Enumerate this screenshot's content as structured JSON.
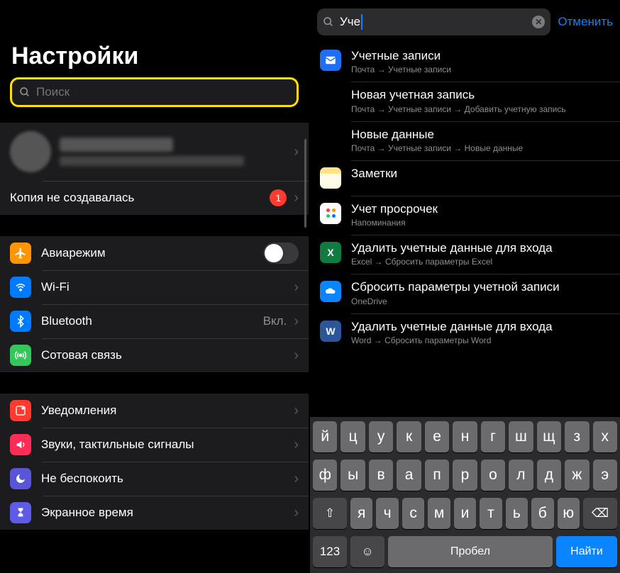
{
  "left": {
    "title": "Настройки",
    "search_placeholder": "Поиск",
    "backup_label": "Копия не создавалась",
    "backup_badge": "1",
    "rows1": [
      {
        "label": "Авиарежим"
      },
      {
        "label": "Wi-Fi"
      },
      {
        "label": "Bluetooth",
        "value": "Вкл."
      },
      {
        "label": "Сотовая связь"
      }
    ],
    "rows2": [
      {
        "label": "Уведомления"
      },
      {
        "label": "Звуки, тактильные сигналы"
      },
      {
        "label": "Не беспокоить"
      },
      {
        "label": "Экранное время"
      }
    ]
  },
  "right": {
    "query": "Уче",
    "cancel": "Отменить",
    "results": [
      {
        "icon": "mail",
        "title": "Учетные записи",
        "crumb": "Почта → Учетные записи"
      },
      {
        "icon": "none",
        "title": "Новая учетная запись",
        "crumb": "Почта → Учетные записи → Добавить учетную запись"
      },
      {
        "icon": "none",
        "title": "Новые данные",
        "crumb": "Почта → Учетные записи → Новые данные"
      },
      {
        "icon": "notes",
        "title": "Заметки",
        "crumb": ""
      },
      {
        "icon": "rem",
        "title": "Учет просрочек",
        "crumb": "Напоминания"
      },
      {
        "icon": "excel",
        "title": "Удалить учетные данные для входа",
        "crumb": "Excel → Сбросить параметры Excel"
      },
      {
        "icon": "od",
        "title": "Сбросить параметры учетной записи",
        "crumb": "OneDrive"
      },
      {
        "icon": "word",
        "title": "Удалить учетные данные для входа",
        "crumb": "Word → Сбросить параметры Word"
      }
    ],
    "keyboard": {
      "row1": [
        "й",
        "ц",
        "у",
        "к",
        "е",
        "н",
        "г",
        "ш",
        "щ",
        "з",
        "х"
      ],
      "row2": [
        "ф",
        "ы",
        "в",
        "а",
        "п",
        "р",
        "о",
        "л",
        "д",
        "ж",
        "э"
      ],
      "row3": [
        "я",
        "ч",
        "с",
        "м",
        "и",
        "т",
        "ь",
        "б",
        "ю"
      ],
      "shift": "⇧",
      "backspace": "⌫",
      "numbers": "123",
      "emoji": "☺",
      "space": "Пробел",
      "find": "Найти"
    }
  }
}
